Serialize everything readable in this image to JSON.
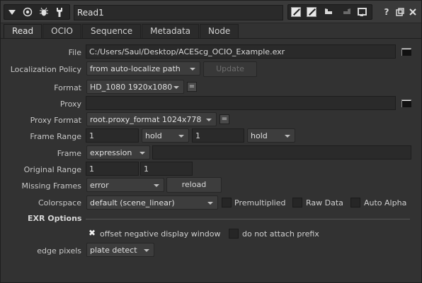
{
  "node": {
    "name": "Read1"
  },
  "title_icons": [
    "chevron-down-icon",
    "record-icon",
    "bug-icon",
    "wrench-icon",
    "square-icon",
    "split-square-icon",
    "undo-icon",
    "redo-icon",
    "revert-icon",
    "help-icon",
    "float-icon",
    "close-icon"
  ],
  "tabs": [
    "Read",
    "OCIO",
    "Sequence",
    "Metadata",
    "Node"
  ],
  "knobs": {
    "file": {
      "label": "File",
      "value": "C:/Users/Saul/Desktop/ACEScg_OCIO_Example.exr"
    },
    "localization": {
      "label": "Localization Policy",
      "value": "from auto-localize path",
      "update_label": "Update"
    },
    "format": {
      "label": "Format",
      "value": "HD_1080 1920x1080",
      "eq": "="
    },
    "proxy": {
      "label": "Proxy",
      "value": ""
    },
    "proxy_format": {
      "label": "Proxy Format",
      "value": "root.proxy_format 1024x778",
      "eq": "="
    },
    "frame_range": {
      "label": "Frame Range",
      "start": "1",
      "start_mode": "hold",
      "end": "1",
      "end_mode": "hold"
    },
    "frame": {
      "label": "Frame",
      "mode": "expression",
      "value": ""
    },
    "original_range": {
      "label": "Original Range",
      "start": "1",
      "end": "1"
    },
    "missing_frames": {
      "label": "Missing Frames",
      "value": "error",
      "reload_label": "reload"
    },
    "colorspace": {
      "label": "Colorspace",
      "value": "default (scene_linear)"
    },
    "premultiplied": {
      "label": "Premultiplied",
      "checked": false
    },
    "raw_data": {
      "label": "Raw Data",
      "checked": false
    },
    "auto_alpha": {
      "label": "Auto Alpha",
      "checked": false
    }
  },
  "exr": {
    "section_label": "EXR Options",
    "offset_negative": {
      "label": "offset negative display window",
      "checked": true
    },
    "no_prefix": {
      "label": "do not attach prefix",
      "checked": false
    },
    "edge_pixels": {
      "label": "edge pixels",
      "value": "plate detect"
    }
  }
}
